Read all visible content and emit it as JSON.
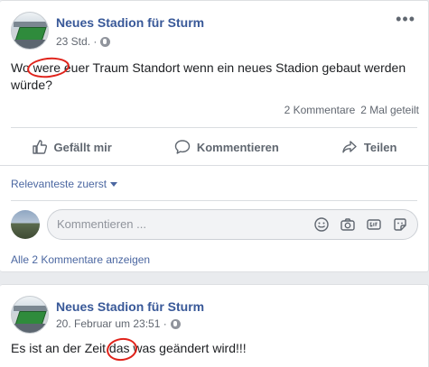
{
  "post1": {
    "page_name": "Neues Stadion für Sturm",
    "time": "23 Std. ·",
    "text": "Wo were euer Traum Standort wenn ein neues Stadion gebaut werden würde?",
    "comments_count": "2 Kommentare",
    "shares_count": "2 Mal geteilt",
    "actions": {
      "like": "Gefällt mir",
      "comment": "Kommentieren",
      "share": "Teilen"
    },
    "sort_label": "Relevanteste zuerst",
    "comment_placeholder": "Kommentieren ...",
    "all_comments_label": "Alle 2 Kommentare anzeigen",
    "more_icon": "more-options-icon"
  },
  "post2": {
    "page_name": "Neues Stadion für Sturm",
    "time": "20. Februar um 23:51 ·",
    "text": "Es ist an der Zeit das was geändert wird!!!"
  },
  "colors": {
    "brand": "#385898",
    "link": "#4b67a1",
    "annotation": "#e0231b",
    "background": "#e9ebee"
  }
}
